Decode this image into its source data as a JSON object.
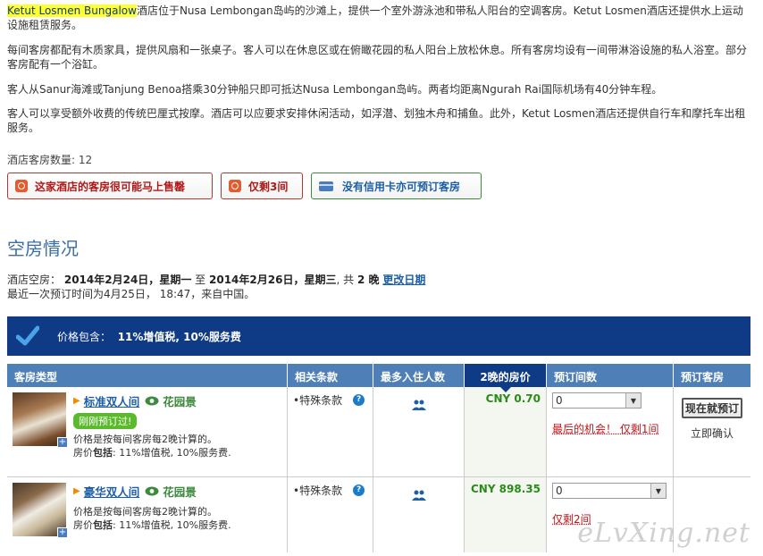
{
  "description": {
    "hotel_name": "Ketut Losmen Bungalow",
    "p1_rest": "酒店位于Nusa Lembongan岛屿的沙滩上，提供一个室外游泳池和带私人阳台的空调客房。Ketut Losmen酒店还提供水上运动设施租赁服务。",
    "p2": "每间客房都配有木质家具，提供风扇和一张桌子。客人可以在休息区或在俯瞰花园的私人阳台上放松休息。所有客房均设有一间带淋浴设施的私人浴室。部分客房配有一个浴缸。",
    "p3": "客人从Sanur海滩或Tanjung Benoa搭乘30分钟船只即可抵达Nusa Lembongan岛屿。两者均距离Ngurah Rai国际机场有40分钟车程。",
    "p4": "客人可以享受额外收费的传统巴厘式按摩。酒店可以应要求安排休闲活动，如浮潜、划独木舟和捕鱼。此外，Ketut Losmen酒店还提供自行车和摩托车出租服务。"
  },
  "room_count": "酒店客房数量: 12",
  "urgency": {
    "sell_out": "这家酒店的客房很可能马上售罄",
    "only_left": "仅剩3间",
    "no_card": "没有信用卡亦可预订客房"
  },
  "availability": {
    "title": "空房情况",
    "label": "酒店空房：",
    "checkin": "2014年2月24日",
    "checkin_dow": "星期一",
    "to": "至",
    "checkout": "2014年2月26日",
    "checkout_dow": "星期三",
    "total_prefix": "共",
    "nights": "2 晚",
    "change_link": "更改日期",
    "recent": "最近一次预订时间为4月25日， 18:47，来自中国。"
  },
  "banner": {
    "label": "价格包含：",
    "value": "11%增值税, 10%服务费"
  },
  "table": {
    "headers": [
      "客房类型",
      "相关条款",
      "最多入住人数",
      "2晚的房价",
      "预订间数",
      "预订客房"
    ],
    "rows": [
      {
        "name": "标准双人间",
        "view": "花园景",
        "badge": "刚刚预订过!",
        "note1": "价格是按每间客房每2晚计算的。",
        "note2_prefix": "房价",
        "note2_bold": "包括",
        "note2_rest": ": 11%增值税, 10%服务费.",
        "term": "•特殊条款",
        "price": "CNY 0.70",
        "select_value": "0",
        "warning": "最后的机会！ 仅剩1间",
        "book_button": "现在就预订",
        "confirm": "立即确认"
      },
      {
        "name": "豪华双人间",
        "view": "花园景",
        "note1": "价格是按每间客房每2晚计算的。",
        "note2_prefix": "房价",
        "note2_bold": "包括",
        "note2_rest": ": 11%增值税, 10%服务费.",
        "term": "•特殊条款",
        "price": "CNY 898.35",
        "select_value": "0",
        "warning": "仅剩2间"
      }
    ]
  },
  "watermark": "eLvXing.net",
  "colors": {
    "banner": "#0e3a86",
    "header": "#4e7fb7",
    "price": "#2a8a1a",
    "warning": "#c0141a",
    "link": "#1c5fa8"
  }
}
